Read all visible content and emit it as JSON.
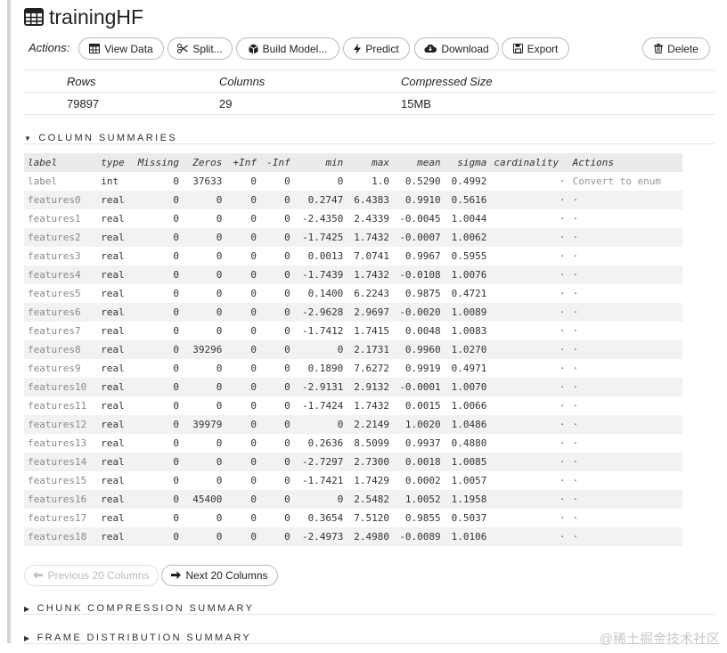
{
  "frame": {
    "title": "trainingHF",
    "icon": "table-icon"
  },
  "actions": {
    "label": "Actions:",
    "buttons": [
      {
        "label": "View Data",
        "icon": "table-icon"
      },
      {
        "label": "Split...",
        "icon": "scissors-icon"
      },
      {
        "label": "Build Model...",
        "icon": "cube-icon"
      },
      {
        "label": "Predict",
        "icon": "bolt-icon"
      },
      {
        "label": "Download",
        "icon": "cloud-download-icon"
      },
      {
        "label": "Export",
        "icon": "save-icon"
      },
      {
        "label": "Delete",
        "icon": "trash-icon"
      }
    ]
  },
  "summary": {
    "headers": [
      "Rows",
      "Columns",
      "Compressed Size"
    ],
    "values": [
      "79897",
      "29",
      "15MB"
    ]
  },
  "column_summaries": {
    "title": "COLUMN SUMMARIES",
    "headers": [
      "label",
      "type",
      "Missing",
      "Zeros",
      "+Inf",
      "-Inf",
      "min",
      "max",
      "mean",
      "sigma",
      "cardinality",
      "Actions"
    ],
    "rows": [
      [
        "label",
        "int",
        "0",
        "37633",
        "0",
        "0",
        "0",
        "1.0",
        "0.5290",
        "0.4992",
        "·",
        "Convert to enum"
      ],
      [
        "features0",
        "real",
        "0",
        "0",
        "0",
        "0",
        "0.2747",
        "6.4383",
        "0.9910",
        "0.5616",
        "·",
        "·"
      ],
      [
        "features1",
        "real",
        "0",
        "0",
        "0",
        "0",
        "-2.4350",
        "2.4339",
        "-0.0045",
        "1.0044",
        "·",
        "·"
      ],
      [
        "features2",
        "real",
        "0",
        "0",
        "0",
        "0",
        "-1.7425",
        "1.7432",
        "-0.0007",
        "1.0062",
        "·",
        "·"
      ],
      [
        "features3",
        "real",
        "0",
        "0",
        "0",
        "0",
        "0.0013",
        "7.0741",
        "0.9967",
        "0.5955",
        "·",
        "·"
      ],
      [
        "features4",
        "real",
        "0",
        "0",
        "0",
        "0",
        "-1.7439",
        "1.7432",
        "-0.0108",
        "1.0076",
        "·",
        "·"
      ],
      [
        "features5",
        "real",
        "0",
        "0",
        "0",
        "0",
        "0.1400",
        "6.2243",
        "0.9875",
        "0.4721",
        "·",
        "·"
      ],
      [
        "features6",
        "real",
        "0",
        "0",
        "0",
        "0",
        "-2.9628",
        "2.9697",
        "-0.0020",
        "1.0089",
        "·",
        "·"
      ],
      [
        "features7",
        "real",
        "0",
        "0",
        "0",
        "0",
        "-1.7412",
        "1.7415",
        "0.0048",
        "1.0083",
        "·",
        "·"
      ],
      [
        "features8",
        "real",
        "0",
        "39296",
        "0",
        "0",
        "0",
        "2.1731",
        "0.9960",
        "1.0270",
        "·",
        "·"
      ],
      [
        "features9",
        "real",
        "0",
        "0",
        "0",
        "0",
        "0.1890",
        "7.6272",
        "0.9919",
        "0.4971",
        "·",
        "·"
      ],
      [
        "features10",
        "real",
        "0",
        "0",
        "0",
        "0",
        "-2.9131",
        "2.9132",
        "-0.0001",
        "1.0070",
        "·",
        "·"
      ],
      [
        "features11",
        "real",
        "0",
        "0",
        "0",
        "0",
        "-1.7424",
        "1.7432",
        "0.0015",
        "1.0066",
        "·",
        "·"
      ],
      [
        "features12",
        "real",
        "0",
        "39979",
        "0",
        "0",
        "0",
        "2.2149",
        "1.0020",
        "1.0486",
        "·",
        "·"
      ],
      [
        "features13",
        "real",
        "0",
        "0",
        "0",
        "0",
        "0.2636",
        "8.5099",
        "0.9937",
        "0.4880",
        "·",
        "·"
      ],
      [
        "features14",
        "real",
        "0",
        "0",
        "0",
        "0",
        "-2.7297",
        "2.7300",
        "0.0018",
        "1.0085",
        "·",
        "·"
      ],
      [
        "features15",
        "real",
        "0",
        "0",
        "0",
        "0",
        "-1.7421",
        "1.7429",
        "0.0002",
        "1.0057",
        "·",
        "·"
      ],
      [
        "features16",
        "real",
        "0",
        "45400",
        "0",
        "0",
        "0",
        "2.5482",
        "1.0052",
        "1.1958",
        "·",
        "·"
      ],
      [
        "features17",
        "real",
        "0",
        "0",
        "0",
        "0",
        "0.3654",
        "7.5120",
        "0.9855",
        "0.5037",
        "·",
        "·"
      ],
      [
        "features18",
        "real",
        "0",
        "0",
        "0",
        "0",
        "-2.4973",
        "2.4980",
        "-0.0089",
        "1.0106",
        "·",
        "·"
      ]
    ]
  },
  "pagination": {
    "previous_label": "Previous 20 Columns",
    "next_label": "Next 20 Columns"
  },
  "sections": {
    "chunk_compression": "CHUNK COMPRESSION SUMMARY",
    "frame_distribution": "FRAME DISTRIBUTION SUMMARY"
  },
  "watermark": "@稀土掘金技术社区"
}
